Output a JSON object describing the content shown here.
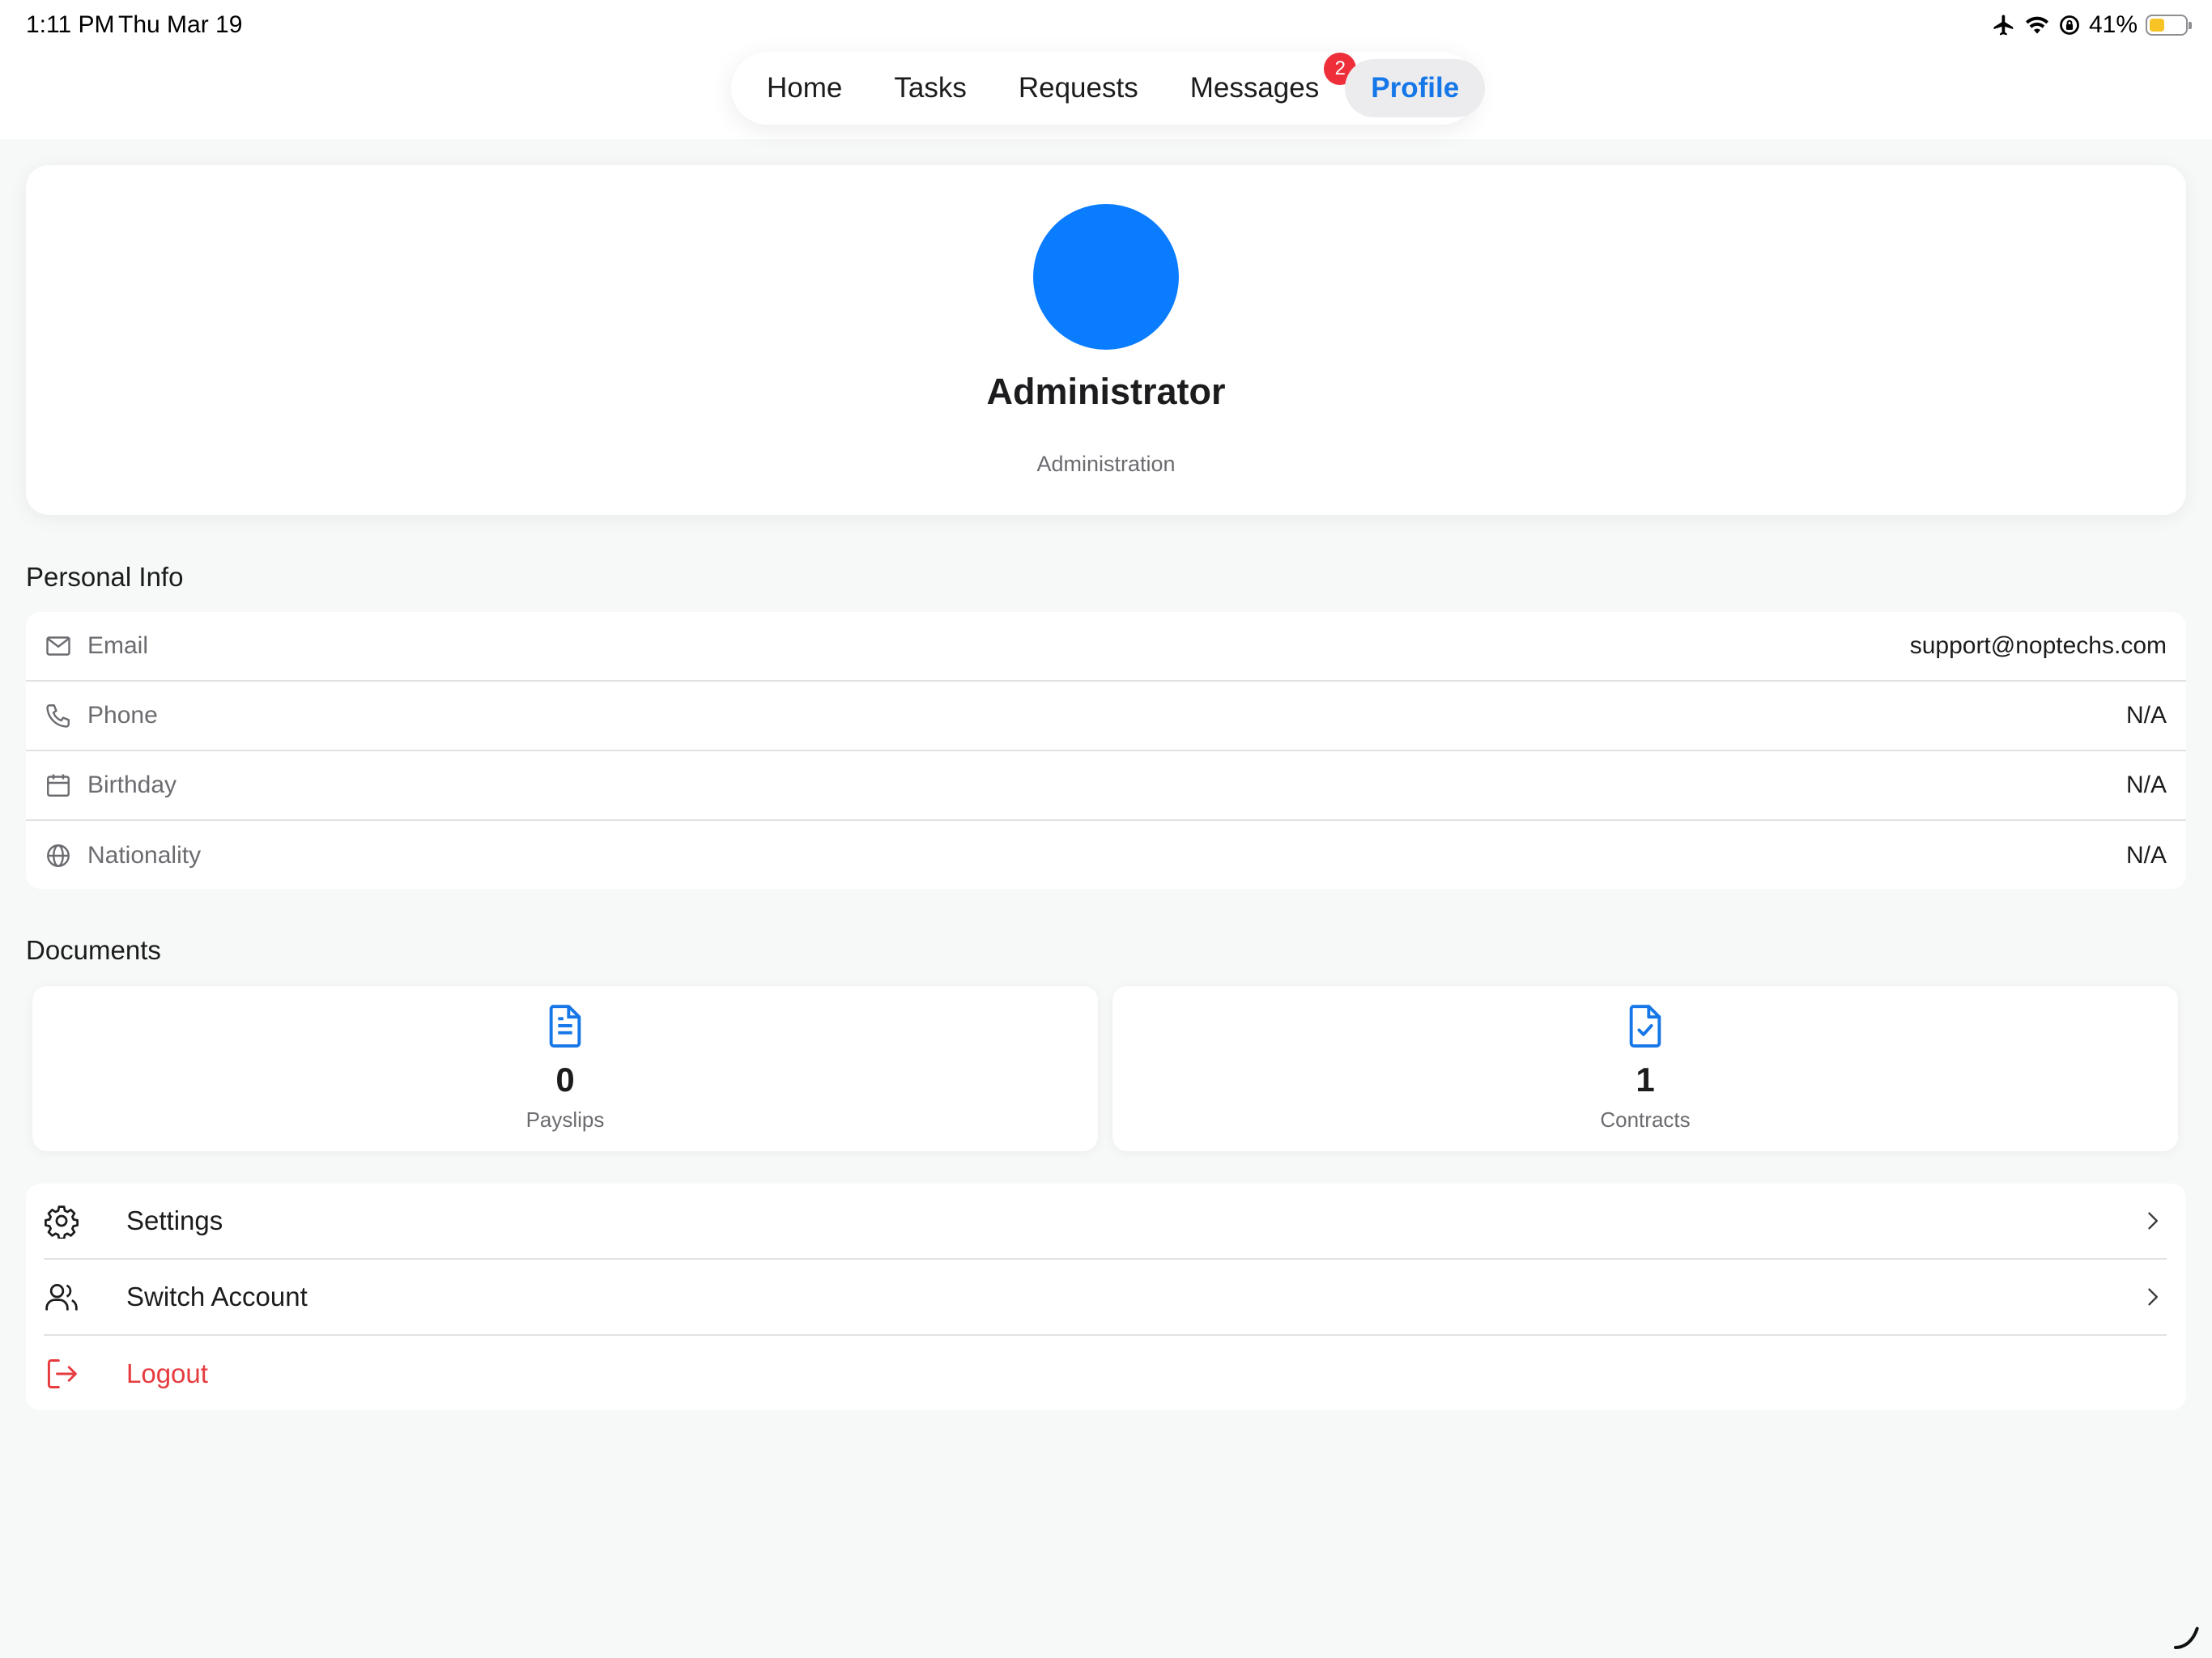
{
  "status_bar": {
    "time": "1:11 PM",
    "date": "Thu Mar 19",
    "battery_text": "41%",
    "battery_level": 0.41,
    "icons": [
      "airplane-icon",
      "wifi-icon",
      "orientation-lock-icon",
      "battery-icon"
    ]
  },
  "nav": {
    "tabs": [
      {
        "label": "Home"
      },
      {
        "label": "Tasks"
      },
      {
        "label": "Requests"
      },
      {
        "label": "Messages",
        "badge": "2"
      },
      {
        "label": "Profile",
        "active": true
      }
    ]
  },
  "profile": {
    "name": "Administrator",
    "department": "Administration",
    "avatar_color": "#0a7cff"
  },
  "personal_info": {
    "title": "Personal Info",
    "rows": [
      {
        "icon": "mail-icon",
        "label": "Email",
        "value": "support@noptechs.com"
      },
      {
        "icon": "phone-icon",
        "label": "Phone",
        "value": "N/A"
      },
      {
        "icon": "calendar-icon",
        "label": "Birthday",
        "value": "N/A"
      },
      {
        "icon": "globe-icon",
        "label": "Nationality",
        "value": "N/A"
      }
    ]
  },
  "documents": {
    "title": "Documents",
    "items": [
      {
        "icon": "document-text-icon",
        "count": "0",
        "label": "Payslips"
      },
      {
        "icon": "document-check-icon",
        "count": "1",
        "label": "Contracts"
      }
    ]
  },
  "menu": {
    "items": [
      {
        "icon": "gear-icon",
        "label": "Settings"
      },
      {
        "icon": "users-icon",
        "label": "Switch Account"
      },
      {
        "icon": "logout-icon",
        "label": "Logout"
      }
    ]
  },
  "colors": {
    "accent": "#1677e8",
    "danger": "#e63b3f",
    "badge": "#ee2f3a",
    "background": "#f7f8f8"
  }
}
